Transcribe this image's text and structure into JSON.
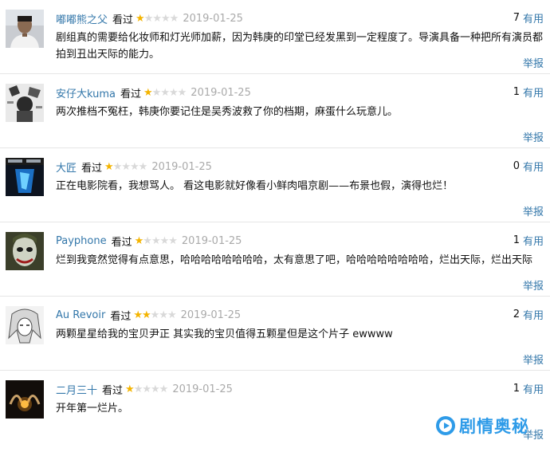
{
  "reviews": [
    {
      "user": "嘟嘟熊之父",
      "watched_label": "看过",
      "rating_stars": 1,
      "rating_max": 5,
      "date": "2019-01-25",
      "useful_count": "7",
      "useful_label": "有用",
      "text": "剧组真的需要给化妆师和灯光师加薪，因为韩庚的印堂已经发黑到一定程度了。导演具备一种把所有演员都拍到丑出天际的能力。",
      "report_label": "举报"
    },
    {
      "user": "安仔大kuma",
      "watched_label": "看过",
      "rating_stars": 1,
      "rating_max": 5,
      "date": "2019-01-25",
      "useful_count": "1",
      "useful_label": "有用",
      "text": "两次推档不冤枉，韩庚你要记住是吴秀波救了你的档期，麻蛋什么玩意儿。",
      "report_label": "举报"
    },
    {
      "user": "大匠",
      "watched_label": "看过",
      "rating_stars": 1,
      "rating_max": 5,
      "date": "2019-01-25",
      "useful_count": "0",
      "useful_label": "有用",
      "text": "正在电影院看，我想骂人。 看这电影就好像看小鲜肉唱京剧——布景也假，演得也烂！",
      "report_label": "举报"
    },
    {
      "user": "Payphone",
      "watched_label": "看过",
      "rating_stars": 1,
      "rating_max": 5,
      "date": "2019-01-25",
      "useful_count": "1",
      "useful_label": "有用",
      "text": "烂到我竟然觉得有点意思，哈哈哈哈哈哈哈哈，太有意思了吧，哈哈哈哈哈哈哈哈，烂出天际，烂出天际",
      "report_label": "举报"
    },
    {
      "user": "Au Revoir",
      "watched_label": "看过",
      "rating_stars": 2,
      "rating_max": 5,
      "date": "2019-01-25",
      "useful_count": "2",
      "useful_label": "有用",
      "text": "两颗星星给我的宝贝尹正 其实我的宝贝值得五颗星但是这个片子 ewwww",
      "report_label": "举报"
    },
    {
      "user": "二月三十",
      "watched_label": "看过",
      "rating_stars": 1,
      "rating_max": 5,
      "date": "2019-01-25",
      "useful_count": "1",
      "useful_label": "有用",
      "text": "开年第一烂片。",
      "report_label": "举报"
    }
  ],
  "watermark": {
    "text": "剧情奥秘",
    "icon": "play-logo-icon"
  },
  "colors": {
    "link": "#3377aa",
    "star_on": "#f4b400",
    "star_off": "#d9d9d9",
    "date": "#aaaaaa",
    "watermark": "#2e9be8"
  }
}
